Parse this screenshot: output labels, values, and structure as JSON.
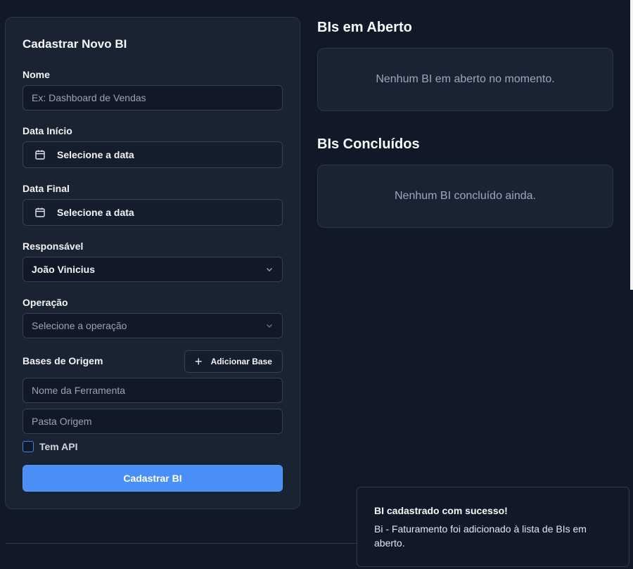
{
  "form": {
    "title": "Cadastrar Novo BI",
    "name_label": "Nome",
    "name_placeholder": "Ex: Dashboard de Vendas",
    "start_date_label": "Data Início",
    "start_date_button": "Selecione a data",
    "end_date_label": "Data Final",
    "end_date_button": "Selecione a data",
    "responsible_label": "Responsável",
    "responsible_value": "João Vinicius",
    "operation_label": "Operação",
    "operation_placeholder": "Selecione a operação",
    "sources_label": "Bases de Origem",
    "add_base_label": "Adicionar Base",
    "tool_name_placeholder": "Nome da Ferramenta",
    "source_folder_placeholder": "Pasta Origem",
    "has_api_label": "Tem API",
    "has_api_checked": false,
    "submit_label": "Cadastrar BI",
    "icons": {
      "calendar": "calendar-icon",
      "chevron": "chevron-down-icon",
      "plus": "plus-icon"
    }
  },
  "open_section": {
    "title": "BIs em Aberto",
    "empty_text": "Nenhum BI em aberto no momento."
  },
  "done_section": {
    "title": "BIs Concluídos",
    "empty_text": "Nenhum BI concluído ainda."
  },
  "toast": {
    "title": "BI cadastrado com sucesso!",
    "description": "Bi - Faturamento foi adicionado à lista de BIs em aberto."
  },
  "colors": {
    "background": "#111827",
    "card": "#1a2332",
    "accent": "#4a8ff5"
  }
}
